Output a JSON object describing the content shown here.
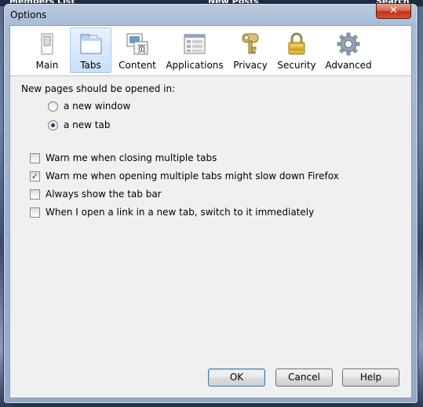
{
  "background": {
    "items": [
      "Members List",
      "New Posts",
      "Search"
    ]
  },
  "window": {
    "title": "Options",
    "close_symbol": "✕"
  },
  "toolbar": {
    "panes": [
      {
        "label": "Main",
        "icon": "switch-icon",
        "selected": false
      },
      {
        "label": "Tabs",
        "icon": "tabs-icon",
        "selected": true
      },
      {
        "label": "Content",
        "icon": "content-icon",
        "selected": false
      },
      {
        "label": "Applications",
        "icon": "applications-icon",
        "selected": false
      },
      {
        "label": "Privacy",
        "icon": "privacy-key-icon",
        "selected": false
      },
      {
        "label": "Security",
        "icon": "padlock-icon",
        "selected": false
      },
      {
        "label": "Advanced",
        "icon": "gear-icon",
        "selected": false
      }
    ]
  },
  "tabs_panel": {
    "open_in_label": "New pages should be opened in:",
    "radios": [
      {
        "label": "a new window",
        "checked": false
      },
      {
        "label": "a new tab",
        "checked": true
      }
    ],
    "checkboxes": [
      {
        "label": "Warn me when closing multiple tabs",
        "checked": false
      },
      {
        "label": "Warn me when opening multiple tabs might slow down Firefox",
        "checked": true
      },
      {
        "label": "Always show the tab bar",
        "checked": false
      },
      {
        "label": "When I open a link in a new tab, switch to it immediately",
        "checked": false
      }
    ]
  },
  "buttons": {
    "ok": "OK",
    "cancel": "Cancel",
    "help": "Help"
  },
  "colors": {
    "selected_pane": "#c9e0f8",
    "close_button": "#c0321b",
    "check_mark": "#1c3a6e"
  }
}
